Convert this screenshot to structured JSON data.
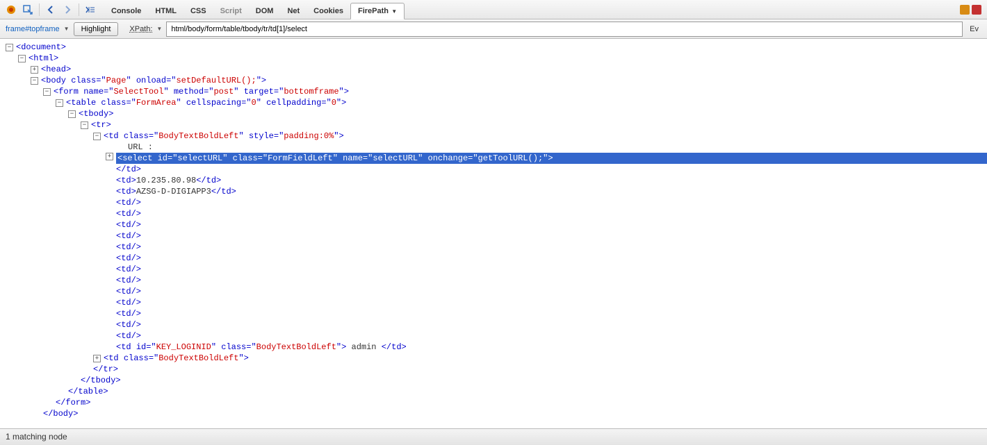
{
  "toolbar": {
    "tabs": [
      "Console",
      "HTML",
      "CSS",
      "Script",
      "DOM",
      "Net",
      "Cookies",
      "FirePath"
    ],
    "active_tab": "FirePath",
    "disabled": [
      "Script"
    ]
  },
  "subbar": {
    "crumb": "frame#topframe",
    "highlight_btn": "Highlight",
    "xpath_label": "XPath:",
    "xpath_value": "html/body/form/table/tbody/tr/td[1]/select",
    "ev": "Ev"
  },
  "tree": {
    "n0": "<document>",
    "n1": {
      "tag": "html"
    },
    "n2": {
      "tag": "head"
    },
    "n3": {
      "tag": "body",
      "attrs": [
        [
          "class",
          "Page"
        ],
        [
          "onload",
          "setDefaultURL();"
        ]
      ]
    },
    "n4": {
      "tag": "form",
      "attrs": [
        [
          "name",
          "SelectTool"
        ],
        [
          "method",
          "post"
        ],
        [
          "target",
          "bottomframe"
        ]
      ]
    },
    "n5": {
      "tag": "table",
      "attrs": [
        [
          "class",
          "FormArea"
        ],
        [
          "cellspacing",
          "0"
        ],
        [
          "cellpadding",
          "0"
        ]
      ]
    },
    "n6": {
      "tag": "tbody"
    },
    "n7": {
      "tag": "tr"
    },
    "n8": {
      "tag": "td",
      "attrs": [
        [
          "class",
          "BodyTextBoldLeft"
        ],
        [
          "style",
          "padding:0%"
        ]
      ]
    },
    "n8txt": "URL :",
    "n9": {
      "tag": "select",
      "attrs": [
        [
          "id",
          "selectURL"
        ],
        [
          "class",
          "FormFieldLeft"
        ],
        [
          "name",
          "selectURL"
        ],
        [
          "onchange",
          "getToolURL();"
        ]
      ]
    },
    "n8c": "</td>",
    "n10": {
      "open": "<td>",
      "txt": "10.235.80.98",
      "close": "</td>"
    },
    "n11": {
      "open": "<td>",
      "txt": "AZSG-D-DIGIAPP3",
      "close": "</td>"
    },
    "ntd": "<td/>",
    "n12": {
      "tag": "td",
      "attrs": [
        [
          "id",
          "KEY_LOGINID"
        ],
        [
          "class",
          "BodyTextBoldLeft"
        ]
      ],
      "txt": " admin ",
      "close": "</td>"
    },
    "n13": {
      "tag": "td",
      "attrs": [
        [
          "class",
          "BodyTextBoldLeft"
        ]
      ]
    },
    "n7c": "</tr>",
    "n6c": "</tbody>",
    "n5c": "</table>",
    "n4c": "</form>",
    "n3c": "</body>"
  },
  "status": "1 matching node"
}
